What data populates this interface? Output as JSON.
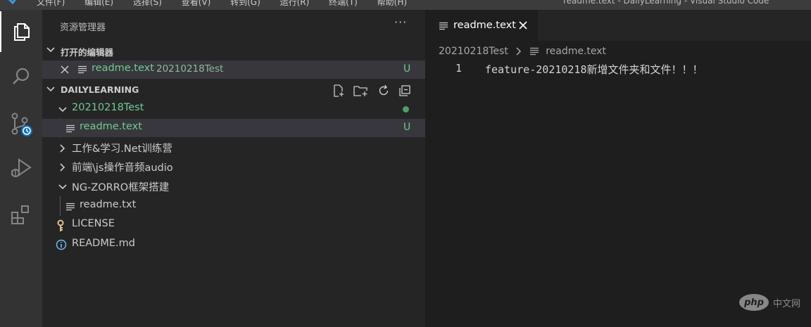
{
  "menubar": {
    "items": [
      "文件(F)",
      "编辑(E)",
      "选择(S)",
      "查看(V)",
      "转到(G)",
      "运行(R)",
      "终端(T)",
      "帮助(H)"
    ],
    "window_title": "readme.text - DailyLearning - Visual Studio Code"
  },
  "activity": {
    "icons": [
      "explorer-icon",
      "search-icon",
      "source-control-icon",
      "run-debug-icon",
      "extensions-icon"
    ]
  },
  "sidebar": {
    "title": "资源管理器",
    "more": "···",
    "open_editors": {
      "label": "打开的编辑器",
      "items": [
        {
          "name": "readme.text",
          "folder": "20210218Test",
          "status": "U"
        }
      ]
    },
    "workspace": {
      "label": "DAILYLEARNING",
      "tree": [
        {
          "name": "20210218Test",
          "type": "folder",
          "expanded": true,
          "status": "dot"
        },
        {
          "name": "readme.text",
          "type": "file",
          "status": "U"
        },
        {
          "name": "工作&学习.Net训练营",
          "type": "folder",
          "expanded": false
        },
        {
          "name": "前端\\js操作音频audio",
          "type": "folder",
          "expanded": false
        },
        {
          "name": "NG-ZORRO框架搭建",
          "type": "folder",
          "expanded": true
        },
        {
          "name": "readme.txt",
          "type": "file"
        },
        {
          "name": "LICENSE",
          "type": "file"
        },
        {
          "name": "README.md",
          "type": "file"
        }
      ]
    }
  },
  "editor": {
    "tab_label": "readme.text",
    "breadcrumb": {
      "folder": "20210218Test",
      "file": "readme.text"
    },
    "lines": [
      {
        "number": "1",
        "text": "feature-20210218新增文件夹和文件！！！"
      }
    ]
  },
  "watermark": {
    "badge": "php",
    "text": "中文网"
  },
  "colors": {
    "accent_green": "#73c991",
    "activity_bar": "#333333",
    "sidebar": "#252526",
    "editor": "#1e1e1e",
    "selection": "#37373d"
  }
}
